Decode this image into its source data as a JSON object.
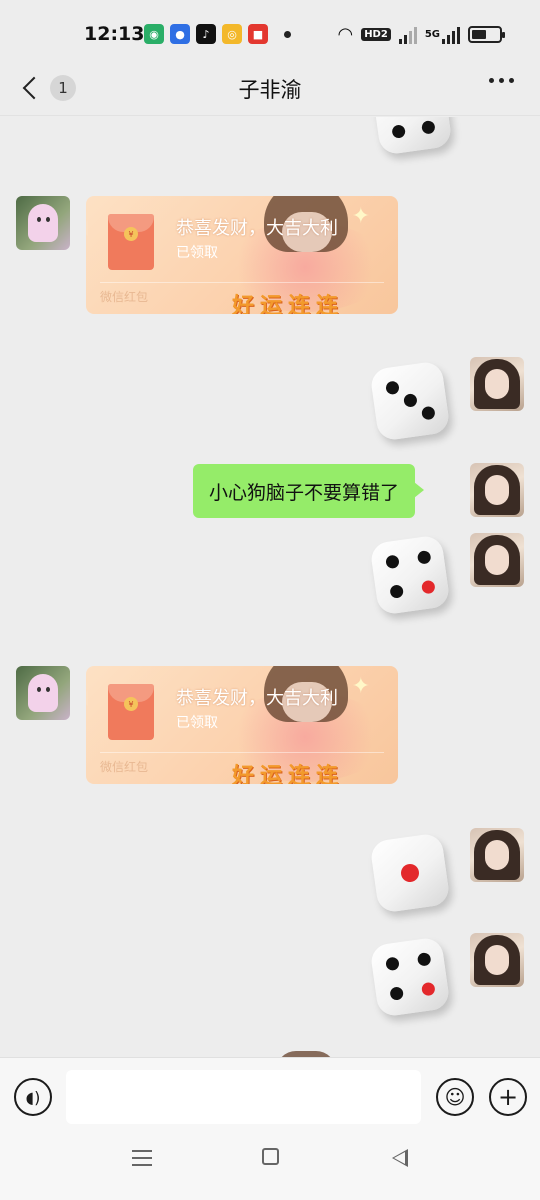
{
  "status_bar": {
    "time": "12:13",
    "app_icons": [
      "wechat-icon",
      "baidu-icon",
      "douyin-icon",
      "weibo-icon",
      "app-icon"
    ],
    "network_badge": "HD2",
    "network_type": "5G",
    "battery_level": 0.55
  },
  "header": {
    "unread_count": "1",
    "title": "子非渝",
    "more_icon": "more-dots-icon"
  },
  "messages": [
    {
      "type": "dice",
      "side": "right",
      "face": 4,
      "partial": true
    },
    {
      "type": "red_packet",
      "side": "left",
      "title": "恭喜发财，大吉大利",
      "status": "已领取",
      "footer": "微信红包",
      "blessing": "好运连连"
    },
    {
      "type": "dice",
      "side": "right",
      "face": 3
    },
    {
      "type": "text",
      "side": "right",
      "text": "小心狗脑子不要算错了"
    },
    {
      "type": "dice",
      "side": "right",
      "face": 4
    },
    {
      "type": "red_packet",
      "side": "left",
      "title": "恭喜发财，大吉大利",
      "status": "已领取",
      "footer": "微信红包",
      "blessing": "好运连连"
    },
    {
      "type": "dice",
      "side": "right",
      "face": 1
    },
    {
      "type": "dice",
      "side": "right",
      "face": 4
    }
  ],
  "input_bar": {
    "voice_icon": "voice-icon",
    "input_value": "",
    "emoji_icon": "emoji-icon",
    "plus_icon": "plus-icon"
  },
  "system_nav": [
    "menu-icon",
    "home-icon",
    "back-icon"
  ],
  "colors": {
    "background": "#ededed",
    "sent_bubble": "#95ec69",
    "red_packet": "#fcd3b0"
  }
}
